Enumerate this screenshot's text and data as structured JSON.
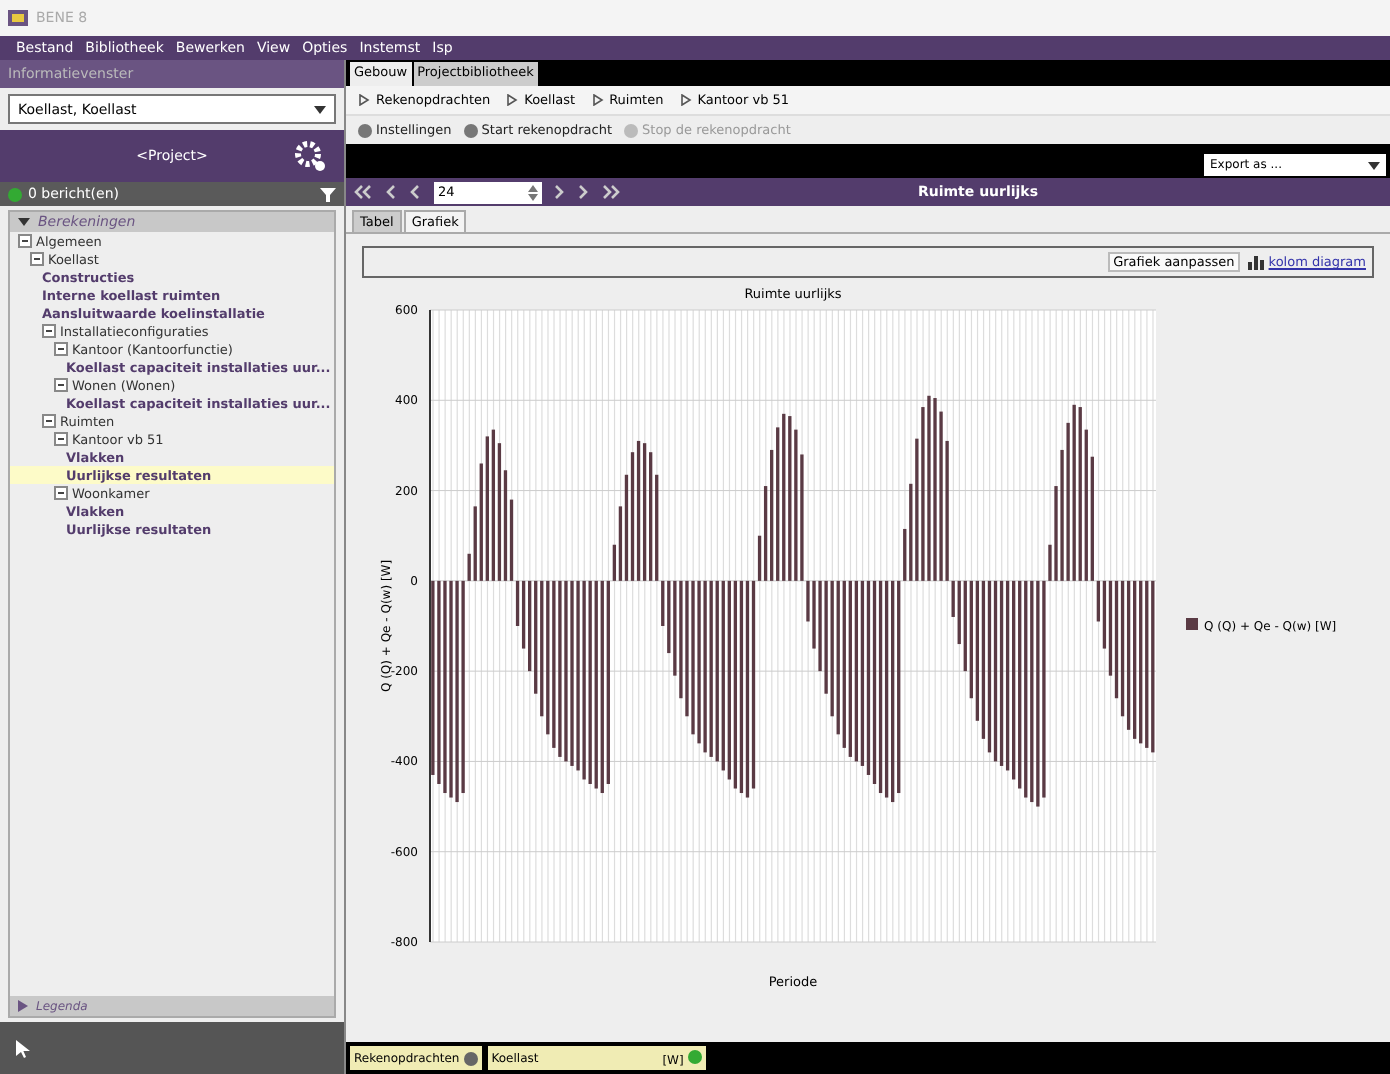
{
  "window": {
    "title": "BENE 8"
  },
  "menu": [
    "Bestand",
    "Bibliotheek",
    "Bewerken",
    "View",
    "Opties",
    "Instemst",
    "Isp"
  ],
  "left": {
    "panel_title": "Informatievenster",
    "selector": "Koellast, Koellast",
    "project": "<Project>",
    "messages": "0 bericht(en)",
    "filter_header": "Berekeningen",
    "legend": "Legenda",
    "tree": [
      {
        "label": "Algemeen",
        "expanded": true,
        "selected": false,
        "children": [
          {
            "label": "Koellast",
            "expanded": true,
            "selected": false,
            "children": [
              {
                "label": "Constructies",
                "selected": false
              },
              {
                "label": "Interne koellast ruimten",
                "selected": false
              },
              {
                "label": "Aansluitwaarde koelinstallatie",
                "selected": false
              },
              {
                "label": "Installatieconfiguraties",
                "expanded": true,
                "selected": false,
                "children": [
                  {
                    "label": "Kantoor (Kantoorfunctie)",
                    "expanded": true,
                    "selected": false,
                    "children": [
                      {
                        "label": "Koellast capaciteit installaties uur...",
                        "selected": false
                      }
                    ]
                  },
                  {
                    "label": "Wonen (Wonen)",
                    "expanded": true,
                    "selected": false,
                    "children": [
                      {
                        "label": "Koellast capaciteit installaties uur...",
                        "selected": false
                      }
                    ]
                  }
                ]
              },
              {
                "label": "Ruimten",
                "expanded": true,
                "selected": false,
                "children": [
                  {
                    "label": "Kantoor vb 51",
                    "expanded": true,
                    "selected": false,
                    "children": [
                      {
                        "label": "Vlakken",
                        "selected": false
                      },
                      {
                        "label": "Uurlijkse resultaten",
                        "selected": true
                      }
                    ]
                  },
                  {
                    "label": "Woonkamer",
                    "expanded": true,
                    "selected": false,
                    "children": [
                      {
                        "label": "Vlakken",
                        "selected": false
                      },
                      {
                        "label": "Uurlijkse resultaten",
                        "selected": false
                      }
                    ]
                  }
                ]
              }
            ]
          }
        ]
      }
    ]
  },
  "top_tabs": [
    {
      "label": "Gebouw",
      "selected": true
    },
    {
      "label": "Projectbibliotheek",
      "selected": false
    }
  ],
  "breadcrumb": [
    "Rekenopdrachten",
    "Koellast",
    "Ruimten",
    "Kantoor vb 51"
  ],
  "actions": [
    {
      "label": "Instellingen",
      "disabled": false
    },
    {
      "label": "Start rekenopdracht",
      "disabled": false
    },
    {
      "label": "Stop de rekenopdracht",
      "disabled": true
    }
  ],
  "export": "Export as ...",
  "nav": {
    "value": "24",
    "title": "Ruimte uurlijks"
  },
  "view_tabs": [
    {
      "label": "Tabel",
      "selected": false
    },
    {
      "label": "Grafiek",
      "selected": true
    }
  ],
  "chart_buttons": {
    "settings": "Grafiek aanpassen",
    "type": "kolom diagram"
  },
  "chart": {
    "chart_data": {
      "type": "bar",
      "title": "Ruimte uurlijks",
      "xlabel": "Periode",
      "ylabel": "Q (Q) + Qe - Q(w) [W]",
      "ylim": [
        -800,
        600
      ],
      "grid": true,
      "yticks": [
        600,
        400,
        200,
        0,
        -200,
        -400,
        -600,
        -800
      ],
      "series": [
        {
          "name": "Q (Q) + Qe - Q(w) [W]",
          "color": "#5a3a44",
          "values": [
            -430,
            -450,
            -470,
            -480,
            -490,
            -470,
            60,
            165,
            260,
            320,
            335,
            305,
            245,
            180,
            -100,
            -150,
            -200,
            -250,
            -300,
            -340,
            -370,
            -390,
            -400,
            -410,
            -420,
            -440,
            -450,
            -460,
            -470,
            -450,
            80,
            165,
            235,
            285,
            310,
            305,
            285,
            235,
            -100,
            -160,
            -210,
            -260,
            -300,
            -340,
            -360,
            -380,
            -390,
            -400,
            -420,
            -440,
            -460,
            -470,
            -480,
            -460,
            100,
            210,
            290,
            340,
            370,
            365,
            335,
            280,
            -90,
            -150,
            -200,
            -250,
            -300,
            -340,
            -370,
            -390,
            -400,
            -410,
            -430,
            -450,
            -470,
            -480,
            -490,
            -470,
            115,
            215,
            315,
            385,
            410,
            405,
            375,
            310,
            -80,
            -140,
            -200,
            -260,
            -310,
            -350,
            -380,
            -400,
            -410,
            -420,
            -440,
            -460,
            -480,
            -490,
            -500,
            -480,
            80,
            210,
            290,
            350,
            390,
            385,
            335,
            275,
            -90,
            -150,
            -210,
            -260,
            -300,
            -330,
            -350,
            -360,
            -370,
            -380
          ]
        }
      ]
    }
  },
  "status": [
    {
      "label": "Rekenopdrachten",
      "kind": "button"
    },
    {
      "label": "Koellast",
      "unit": "[W]",
      "kind": "field"
    }
  ]
}
